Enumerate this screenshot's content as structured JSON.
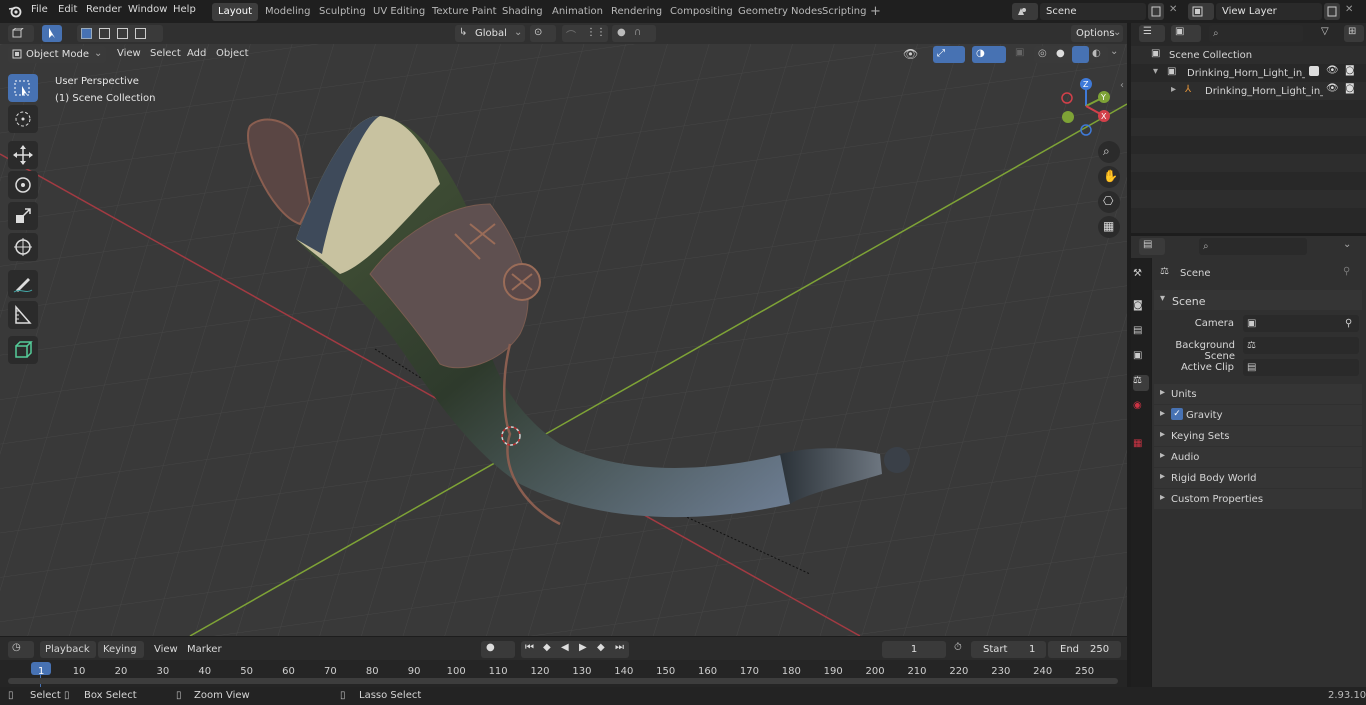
{
  "topbar": {
    "menus": [
      "File",
      "Edit",
      "Render",
      "Window",
      "Help"
    ],
    "workspaces": [
      "Layout",
      "Modeling",
      "Sculpting",
      "UV Editing",
      "Texture Paint",
      "Shading",
      "Animation",
      "Rendering",
      "Compositing",
      "Geometry Nodes",
      "Scripting"
    ],
    "active_workspace": "Layout",
    "scene_name": "Scene",
    "view_layer": "View Layer"
  },
  "viewport": {
    "mode": "Object Mode",
    "menus": [
      "View",
      "Select",
      "Add",
      "Object"
    ],
    "orientation": "Global",
    "options_label": "Options",
    "overlay_line1": "User Perspective",
    "overlay_line2": "(1) Scene Collection",
    "gizmo": {
      "z": "Z",
      "y": "Y",
      "x": "X"
    }
  },
  "outliner": {
    "root": "Scene Collection",
    "items": [
      {
        "label": "Drinking_Horn_Light_in_Leath"
      },
      {
        "label": "Drinking_Horn_Light_in_L"
      }
    ]
  },
  "properties": {
    "header": "Scene",
    "panel_title": "Scene",
    "camera_label": "Camera",
    "background_label": "Background Scene",
    "clip_label": "Active Clip",
    "sections": [
      "Units",
      "Gravity",
      "Keying Sets",
      "Audio",
      "Rigid Body World",
      "Custom Properties"
    ],
    "gravity_checked": true
  },
  "timeline": {
    "menus": [
      "Playback",
      "Keying",
      "View",
      "Marker"
    ],
    "current_frame": "1",
    "start_label": "Start",
    "start_value": "1",
    "end_label": "End",
    "end_value": "250",
    "ruler": [
      "1",
      "10",
      "20",
      "30",
      "40",
      "50",
      "60",
      "70",
      "80",
      "90",
      "100",
      "110",
      "120",
      "130",
      "140",
      "150",
      "160",
      "170",
      "180",
      "190",
      "200",
      "210",
      "220",
      "230",
      "240",
      "250"
    ]
  },
  "statusbar": {
    "select": "Select",
    "box_select": "Box Select",
    "zoom_view": "Zoom View",
    "lasso_select": "Lasso Select",
    "version": "2.93.10"
  },
  "colors": {
    "accent": "#4772b3",
    "x_axis": "#a23a42",
    "y_axis": "#7ea336",
    "viewport_bg": "#393939"
  }
}
